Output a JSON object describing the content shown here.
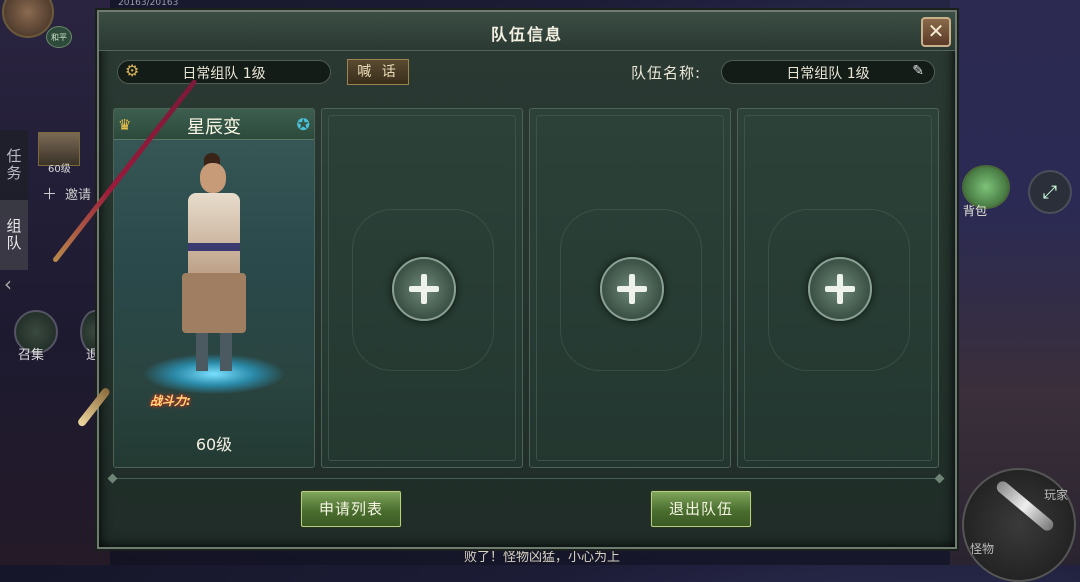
{
  "hud": {
    "hp_text": "20163/20163",
    "peace_badge": "和平",
    "tab_task": "任务",
    "tab_team": "组队",
    "side_member_level": "60级",
    "side_invite": "邀请",
    "gather_label": "召集",
    "retreat_label": "退",
    "bag_label": "背包",
    "attack_label_top": "玩家",
    "attack_label_bottom": "怪物",
    "bottom_message": "败了！怪物凶猛，小心为上"
  },
  "dialog": {
    "title": "队伍信息",
    "close": "✕",
    "target_select": "日常组队 1级",
    "shout_button": "喊 话",
    "team_name_label": "队伍名称:",
    "team_name_value": "日常组队 1级"
  },
  "member": {
    "name": "星辰变",
    "power_label": "战斗力:",
    "level": "60级"
  },
  "empty_slots": 3,
  "buttons": {
    "apply_list": "申请列表",
    "leave_team": "退出队伍"
  }
}
